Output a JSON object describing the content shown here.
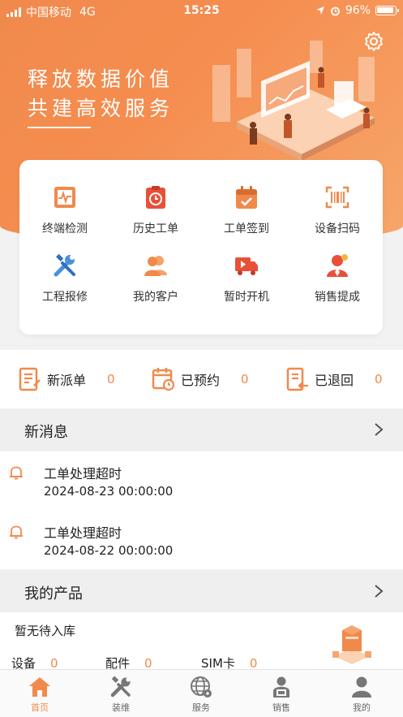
{
  "status_bar": {
    "carrier": "中国移动",
    "network": "4G",
    "time": "15:25",
    "battery": "96%"
  },
  "hero": {
    "line1": "释放数据价值",
    "line2": "共建高效服务"
  },
  "grid": [
    {
      "label": "终端检测",
      "icon": "terminal-check-icon"
    },
    {
      "label": "历史工单",
      "icon": "history-order-icon"
    },
    {
      "label": "工单签到",
      "icon": "order-checkin-icon"
    },
    {
      "label": "设备扫码",
      "icon": "barcode-scan-icon"
    },
    {
      "label": "工程报修",
      "icon": "repair-tools-icon"
    },
    {
      "label": "我的客户",
      "icon": "customers-icon"
    },
    {
      "label": "暂时开机",
      "icon": "truck-play-icon"
    },
    {
      "label": "销售提成",
      "icon": "sales-commission-icon"
    }
  ],
  "stats": [
    {
      "label": "新派单",
      "value": "0"
    },
    {
      "label": "已预约",
      "value": "0"
    },
    {
      "label": "已退回",
      "value": "0"
    }
  ],
  "messages": {
    "title": "新消息",
    "items": [
      {
        "text": "工单处理超时",
        "time": "2024-08-23 00:00:00"
      },
      {
        "text": "工单处理超时",
        "time": "2024-08-22 00:00:00"
      }
    ]
  },
  "products": {
    "title": "我的产品",
    "empty": "暂无待入库",
    "counts": [
      {
        "label": "设备",
        "value": "0"
      },
      {
        "label": "配件",
        "value": "0"
      },
      {
        "label": "SIM卡",
        "value": "0"
      }
    ]
  },
  "tabs": [
    {
      "label": "首页",
      "icon": "home-icon",
      "active": true
    },
    {
      "label": "装维",
      "icon": "tools-icon",
      "active": false
    },
    {
      "label": "服务",
      "icon": "globe-icon",
      "active": false
    },
    {
      "label": "销售",
      "icon": "sales-person-icon",
      "active": false
    },
    {
      "label": "我的",
      "icon": "user-icon",
      "active": false
    }
  ],
  "colors": {
    "accent": "#f08a4c",
    "blue": "#4a90e2",
    "red": "#e8503a"
  }
}
